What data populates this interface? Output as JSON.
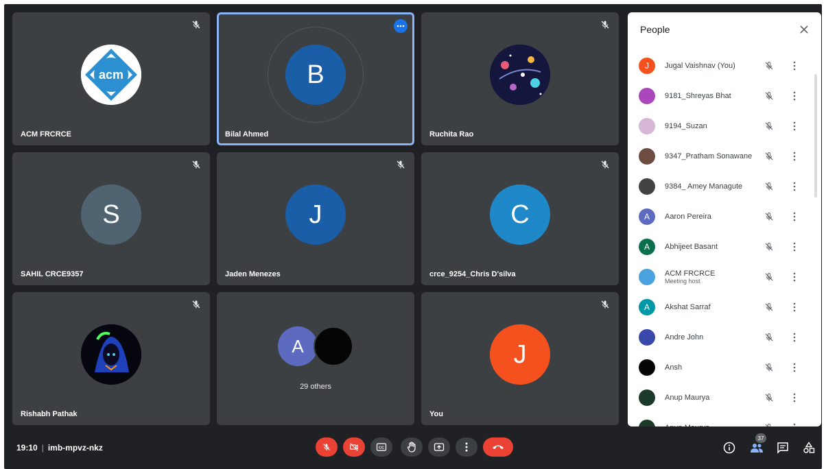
{
  "tiles": [
    {
      "name": "ACM FRCRCE",
      "avatar_type": "acm-logo",
      "logo_text": "acm"
    },
    {
      "name": "Bilal Ahmed",
      "initial": "B",
      "color": "#1a5ea8",
      "active": true
    },
    {
      "name": "Ruchita Rao",
      "avatar_type": "space-image"
    },
    {
      "name": "SAHIL CRCE9357",
      "initial": "S",
      "color": "#4f6470"
    },
    {
      "name": "Jaden Menezes",
      "initial": "J",
      "color": "#1a5ea8"
    },
    {
      "name": "crce_9254_Chris D'silva",
      "initial": "C",
      "color": "#1e88c9"
    },
    {
      "name": "Rishabh Pathak",
      "avatar_type": "art-image"
    },
    {
      "others_initial": "A",
      "others_text": "29 others"
    },
    {
      "name": "You",
      "initial": "J",
      "color": "#f4511e"
    }
  ],
  "panel": {
    "title": "People",
    "people": [
      {
        "name": "Jugal Vaishnav (You)",
        "initial": "J",
        "color": "#f4511e"
      },
      {
        "name": "9181_Shreyas Bhat",
        "color": "#ab47bc"
      },
      {
        "name": "9194_Suzan",
        "color": "#d7b7d9"
      },
      {
        "name": "9347_Pratham Sonawane",
        "color": "#6d4c41"
      },
      {
        "name": "9384_ Amey Managute",
        "color": "#424242"
      },
      {
        "name": "Aaron Pereira",
        "initial": "A",
        "color": "#5c6bc0"
      },
      {
        "name": "Abhijeet Basant",
        "initial": "A",
        "color": "#0b6e4f"
      },
      {
        "name": "ACM FRCRCE",
        "subtitle": "Meeting host",
        "color": "#4aa3df"
      },
      {
        "name": "Akshat Sarraf",
        "initial": "A",
        "color": "#0097a7"
      },
      {
        "name": "Andre John",
        "color": "#3949ab"
      },
      {
        "name": "Ansh",
        "color": "#050505"
      },
      {
        "name": "Anup Maurya",
        "color": "#1b3a2a"
      },
      {
        "name": "Anup Maurya",
        "color": "#1b3a2a"
      }
    ]
  },
  "bottom": {
    "time": "19:10",
    "meeting_code": "imb-mpvz-nkz",
    "participant_count": "37"
  }
}
